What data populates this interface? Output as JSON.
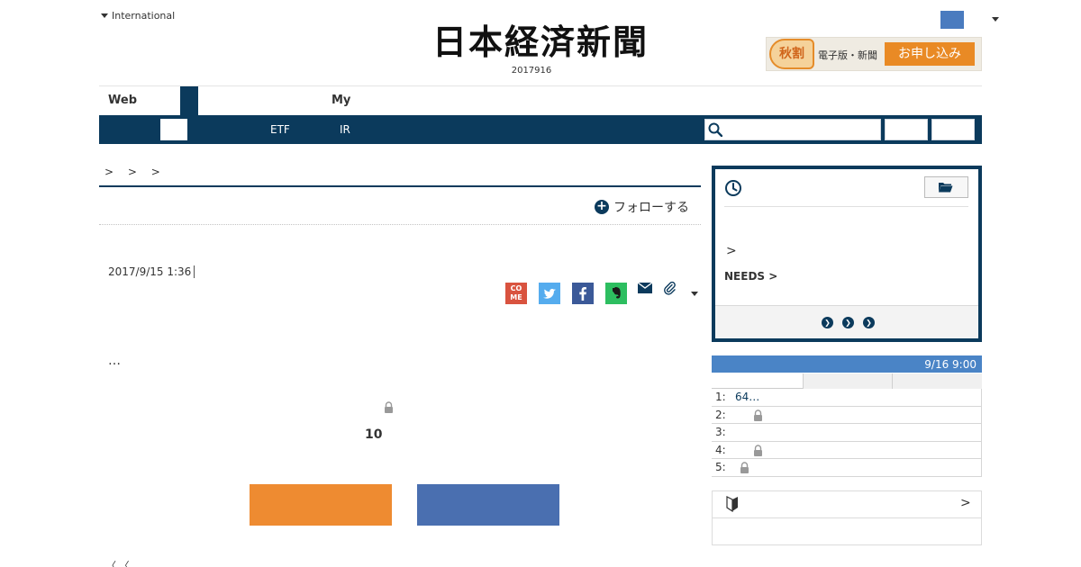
{
  "header": {
    "international_label": "International",
    "logo_text": "日本経済新聞",
    "date": "2017916",
    "promo": {
      "badge": "秋割",
      "text": "電子版・新聞",
      "button": "お申し込み"
    }
  },
  "nav": {
    "primary": {
      "web_label": "Web",
      "my_label": "My"
    },
    "secondary": {
      "etf_label": "ETF",
      "ir_label": "IR"
    }
  },
  "article": {
    "breadcrumb": "> > >",
    "follow_label": "フォローする",
    "timestamp": "2017/9/15 1:36",
    "share": {
      "come_label": "CO ME"
    },
    "teaser": "…",
    "count": "10",
    "cut_text": "〈 〈"
  },
  "sidebar": {
    "history": {
      "chevron": ">",
      "needs_label": "NEEDS >"
    },
    "ranking": {
      "time": "9/16 9:00",
      "items": [
        {
          "num": "1:",
          "title": "64…"
        },
        {
          "num": "2:",
          "title": ""
        },
        {
          "num": "3:",
          "title": ""
        },
        {
          "num": "4:",
          "title": ""
        },
        {
          "num": "5:",
          "title": ""
        }
      ]
    },
    "beginner": {
      "chevron": ">"
    }
  },
  "colors": {
    "navy": "#0b3a5c",
    "accent_blue": "#4a84c6",
    "orange": "#ee8b31",
    "button_blue": "#4a6fb0"
  },
  "icons": [
    "caret-down-icon",
    "search-icon",
    "clock-icon",
    "folder-icon",
    "lock-icon",
    "mail-icon",
    "paperclip-icon",
    "twitter-icon",
    "facebook-icon",
    "evernote-icon",
    "come-icon",
    "beginner-leaf-icon"
  ]
}
